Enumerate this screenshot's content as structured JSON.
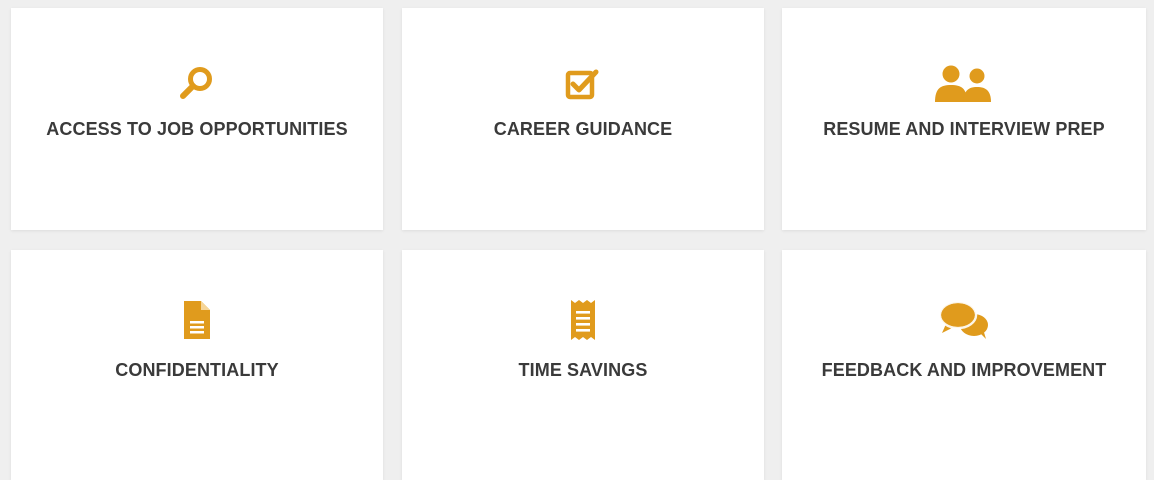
{
  "colors": {
    "accent": "#e09b1d",
    "text": "#3a3a3a",
    "card": "#ffffff",
    "background": "#efefef"
  },
  "cards": [
    {
      "icon": "search-icon",
      "title": "ACCESS TO JOB OPPORTUNITIES"
    },
    {
      "icon": "checked-box-icon",
      "title": "CAREER GUIDANCE"
    },
    {
      "icon": "users-icon",
      "title": "RESUME AND INTERVIEW PREP"
    },
    {
      "icon": "document-icon",
      "title": "CONFIDENTIALITY"
    },
    {
      "icon": "receipt-icon",
      "title": "TIME SAVINGS"
    },
    {
      "icon": "chat-bubbles-icon",
      "title": "FEEDBACK AND IMPROVEMENT"
    }
  ]
}
